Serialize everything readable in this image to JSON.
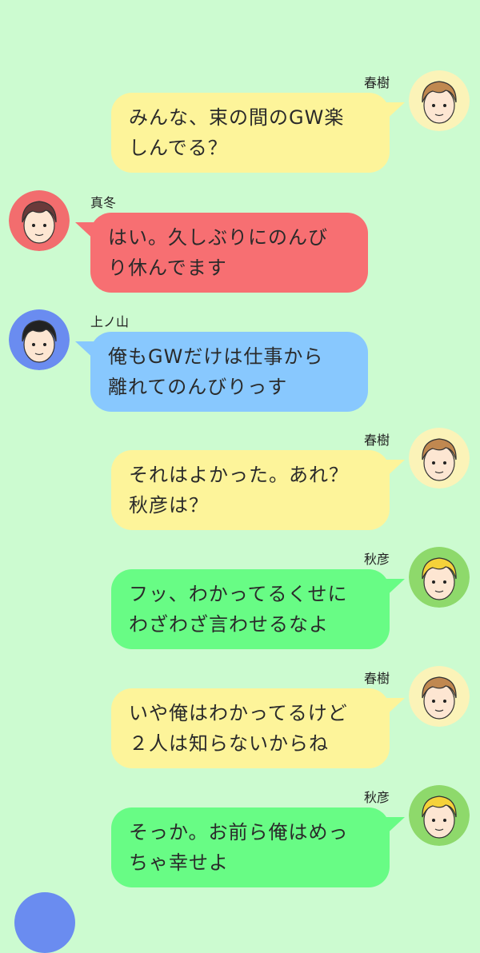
{
  "colors": {
    "background": "#ccfbd0",
    "yellow_bubble": "#fdf49a",
    "red_bubble": "#f76f72",
    "blue_bubble": "#88c8fe",
    "green_bubble": "#68fc85"
  },
  "messages": [
    {
      "side": "right",
      "speaker": "春樹",
      "avatar": "haruki-avatar",
      "color": "#fdf49a",
      "avatar_bg": "#fbf3b8",
      "text": "みんな、束の間のGW楽\nしんでる？"
    },
    {
      "side": "left",
      "speaker": "真冬",
      "avatar": "mafuyu-avatar",
      "color": "#f76f72",
      "avatar_bg": "#f26d6e",
      "text": "はい。久しぶりにのんび\nり休んでます"
    },
    {
      "side": "left",
      "speaker": "上ノ山",
      "avatar": "uenoyama-avatar",
      "color": "#88c8fe",
      "avatar_bg": "#6a8cf0",
      "text": "俺もGWだけは仕事から\n離れてのんびりっす"
    },
    {
      "side": "right",
      "speaker": "春樹",
      "avatar": "haruki-avatar",
      "color": "#fdf49a",
      "avatar_bg": "#fbf3b8",
      "text": "それはよかった。あれ？\n秋彦は？"
    },
    {
      "side": "right",
      "speaker": "秋彦",
      "avatar": "akihiko-avatar",
      "color": "#68fc85",
      "avatar_bg": "#8ed96b",
      "text": "フッ、わかってるくせに\nわざわざ言わせるなよ"
    },
    {
      "side": "right",
      "speaker": "春樹",
      "avatar": "haruki-avatar",
      "color": "#fdf49a",
      "avatar_bg": "#fbf3b8",
      "text": "いや俺はわかってるけど\n２人は知らないからね"
    },
    {
      "side": "right",
      "speaker": "秋彦",
      "avatar": "akihiko-avatar",
      "color": "#68fc85",
      "avatar_bg": "#8ed96b",
      "text": "そっか。お前ら俺はめっ\nちゃ幸せよ"
    }
  ]
}
